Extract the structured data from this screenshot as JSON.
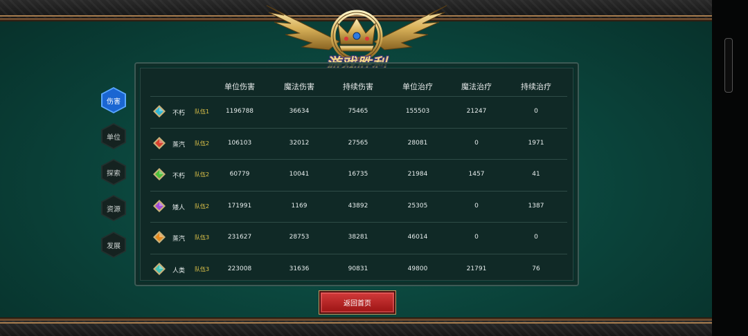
{
  "title": "游戏胜利",
  "tabs": [
    {
      "label": "伤害",
      "active": true
    },
    {
      "label": "单位",
      "active": false
    },
    {
      "label": "探索",
      "active": false
    },
    {
      "label": "资源",
      "active": false
    },
    {
      "label": "发展",
      "active": false
    }
  ],
  "table": {
    "headers": [
      "单位伤害",
      "魔法伤害",
      "持续伤害",
      "单位治疗",
      "魔法治疗",
      "持续治疗"
    ],
    "rows": [
      {
        "gem_color": "#2fb6d6",
        "race": "不朽",
        "team": "队伍1",
        "values": [
          "1196788",
          "36634",
          "75465",
          "155503",
          "21247",
          "0"
        ]
      },
      {
        "gem_color": "#d8402e",
        "race": "蒸汽",
        "team": "队伍2",
        "values": [
          "106103",
          "32012",
          "27565",
          "28081",
          "0",
          "1971"
        ]
      },
      {
        "gem_color": "#4dbf3a",
        "race": "不朽",
        "team": "队伍2",
        "values": [
          "60779",
          "10041",
          "16735",
          "21984",
          "1457",
          "41"
        ]
      },
      {
        "gem_color": "#a24bd8",
        "race": "矮人",
        "team": "队伍2",
        "values": [
          "171991",
          "1169",
          "43892",
          "25305",
          "0",
          "1387"
        ]
      },
      {
        "gem_color": "#e58a1f",
        "race": "蒸汽",
        "team": "队伍3",
        "values": [
          "231627",
          "28753",
          "38281",
          "46014",
          "0",
          "0"
        ]
      },
      {
        "gem_color": "#3fc4b8",
        "race": "人类",
        "team": "队伍3",
        "values": [
          "223008",
          "31636",
          "90831",
          "49800",
          "21791",
          "76"
        ]
      }
    ]
  },
  "return_button": "返回首页",
  "colors": {
    "background": "#0b463d",
    "team_label": "#e7c94a",
    "active_tab": "#1b66d2",
    "button": "#b01e1e"
  }
}
